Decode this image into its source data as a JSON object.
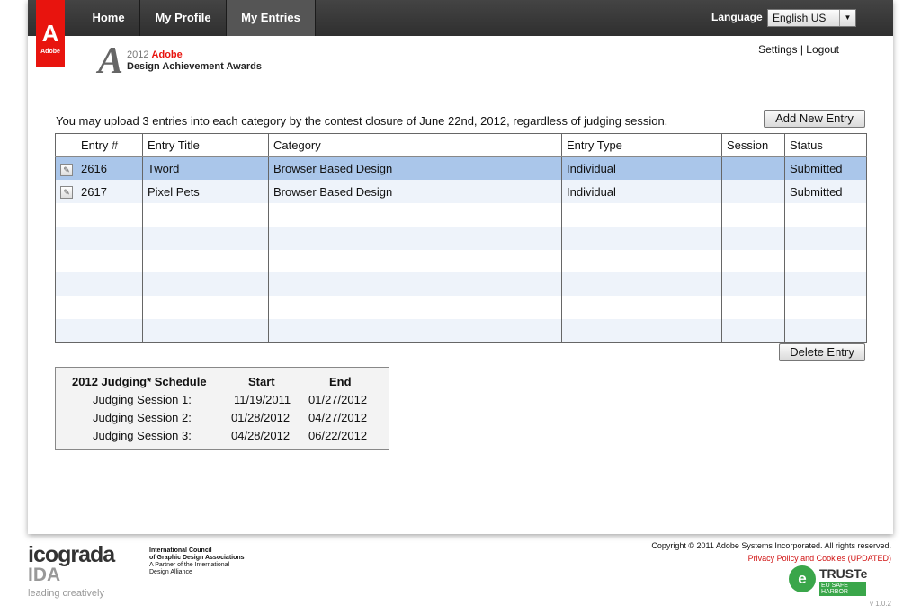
{
  "nav": {
    "tabs": [
      {
        "label": "Home"
      },
      {
        "label": "My Profile"
      },
      {
        "label": "My Entries"
      }
    ],
    "language_label": "Language",
    "language_value": "English US",
    "brand": "Adobe"
  },
  "award_logo": {
    "year": "2012",
    "brand": "Adobe",
    "name": "Design Achievement Awards"
  },
  "user_links": {
    "settings": "Settings",
    "sep": "|",
    "logout": "Logout"
  },
  "notice": "You may upload 3 entries into each category by the contest closure of June 22nd, 2012, regardless of judging session.",
  "buttons": {
    "add": "Add New Entry",
    "delete": "Delete Entry"
  },
  "table": {
    "headers": [
      "Entry #",
      "Entry Title",
      "Category",
      "Entry Type",
      "Session",
      "Status"
    ],
    "rows": [
      {
        "entry": "2616",
        "title": "Tword",
        "category": "Browser Based Design",
        "type": "Individual",
        "session": "",
        "status": "Submitted"
      },
      {
        "entry": "2617",
        "title": "Pixel Pets",
        "category": "Browser Based Design",
        "type": "Individual",
        "session": "",
        "status": "Submitted"
      }
    ]
  },
  "schedule": {
    "title": "2012 Judging* Schedule",
    "start_label": "Start",
    "end_label": "End",
    "sessions": [
      {
        "name": "Judging Session 1:",
        "start": "11/19/2011",
        "end": "01/27/2012"
      },
      {
        "name": "Judging Session 2:",
        "start": "01/28/2012",
        "end": "04/27/2012"
      },
      {
        "name": "Judging Session 3:",
        "start": "04/28/2012",
        "end": "06/22/2012"
      }
    ]
  },
  "footer": {
    "icograda": "icograda",
    "ida": "IDA",
    "tagline": "leading creatively",
    "council_l1": "International Council",
    "council_l2": "of Graphic Design Associations",
    "council_l3": "A Partner of the International",
    "council_l4": "Design Alliance",
    "copyright": "Copyright © 2011 Adobe Systems Incorporated. All rights reserved.",
    "privacy": "Privacy Policy and Cookies (UPDATED)",
    "truste": "TRUSTe",
    "truste_sub": "EU SAFE HARBOR",
    "version": "v 1.0.2"
  }
}
